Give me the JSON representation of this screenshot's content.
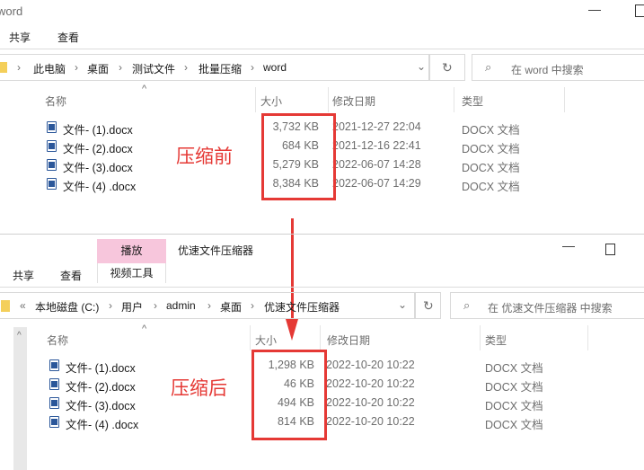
{
  "top": {
    "title": "word",
    "tabs": [
      "共享",
      "查看"
    ],
    "breadcrumb": [
      "此电脑",
      "桌面",
      "测试文件",
      "批量压缩",
      "word"
    ],
    "search_placeholder": "在 word 中搜索",
    "columns": [
      "名称",
      "大小",
      "修改日期",
      "类型"
    ],
    "files": [
      {
        "name": "文件- (1).docx",
        "size": "3,732 KB",
        "date": "2021-12-27 22:04",
        "type": "DOCX 文档"
      },
      {
        "name": "文件- (2).docx",
        "size": "684 KB",
        "date": "2021-12-16 22:41",
        "type": "DOCX 文档"
      },
      {
        "name": "文件- (3).docx",
        "size": "5,279 KB",
        "date": "2022-06-07 14:28",
        "type": "DOCX 文档"
      },
      {
        "name": "文件- (4) .docx",
        "size": "8,384 KB",
        "date": "2022-06-07 14:29",
        "type": "DOCX 文档"
      }
    ],
    "annotation": "压缩前"
  },
  "bottom": {
    "title": "优速文件压缩器",
    "context_tab": "播放",
    "context_group": "视频工具",
    "tabs": [
      "共享",
      "查看"
    ],
    "breadcrumb": [
      "本地磁盘 (C:)",
      "用户",
      "admin",
      "桌面",
      "优速文件压缩器"
    ],
    "search_placeholder": "在 优速文件压缩器 中搜索",
    "columns": [
      "名称",
      "大小",
      "修改日期",
      "类型"
    ],
    "files": [
      {
        "name": "文件- (1).docx",
        "size": "1,298 KB",
        "date": "2022-10-20 10:22",
        "type": "DOCX 文档"
      },
      {
        "name": "文件- (2).docx",
        "size": "46 KB",
        "date": "2022-10-20 10:22",
        "type": "DOCX 文档"
      },
      {
        "name": "文件- (3).docx",
        "size": "494 KB",
        "date": "2022-10-20 10:22",
        "type": "DOCX 文档"
      },
      {
        "name": "文件- (4) .docx",
        "size": "814 KB",
        "date": "2022-10-20 10:22",
        "type": "DOCX 文档"
      }
    ],
    "annotation": "压缩后"
  },
  "colors": {
    "highlight": "#e53935",
    "context_tab": "#f7c6dc"
  }
}
